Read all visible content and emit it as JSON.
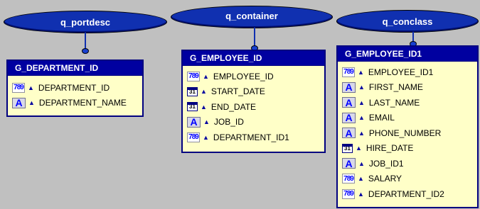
{
  "queries": [
    {
      "name": "q_portdesc"
    },
    {
      "name": "q_container"
    },
    {
      "name": "q_conclass"
    }
  ],
  "groups": [
    {
      "name": "G_DEPARTMENT_ID",
      "columns": [
        {
          "type_icon": "number-icon",
          "icon_text": "789",
          "name": "DEPARTMENT_ID"
        },
        {
          "type_icon": "text-icon",
          "icon_text": "A",
          "name": "DEPARTMENT_NAME"
        }
      ]
    },
    {
      "name": "G_EMPLOYEE_ID",
      "columns": [
        {
          "type_icon": "number-icon",
          "icon_text": "789",
          "name": "EMPLOYEE_ID"
        },
        {
          "type_icon": "date-icon",
          "icon_text": "31",
          "name": "START_DATE"
        },
        {
          "type_icon": "date-icon",
          "icon_text": "31",
          "name": "END_DATE"
        },
        {
          "type_icon": "text-icon",
          "icon_text": "A",
          "name": "JOB_ID"
        },
        {
          "type_icon": "number-icon",
          "icon_text": "789",
          "name": "DEPARTMENT_ID1"
        }
      ]
    },
    {
      "name": "G_EMPLOYEE_ID1",
      "columns": [
        {
          "type_icon": "number-icon",
          "icon_text": "789",
          "name": "EMPLOYEE_ID1"
        },
        {
          "type_icon": "text-icon",
          "icon_text": "A",
          "name": "FIRST_NAME"
        },
        {
          "type_icon": "text-icon",
          "icon_text": "A",
          "name": "LAST_NAME"
        },
        {
          "type_icon": "text-icon",
          "icon_text": "A",
          "name": "EMAIL"
        },
        {
          "type_icon": "text-icon",
          "icon_text": "A",
          "name": "PHONE_NUMBER"
        },
        {
          "type_icon": "date-icon",
          "icon_text": "31",
          "name": "HIRE_DATE"
        },
        {
          "type_icon": "text-icon",
          "icon_text": "A",
          "name": "JOB_ID1"
        },
        {
          "type_icon": "number-icon",
          "icon_text": "789",
          "name": "SALARY"
        },
        {
          "type_icon": "number-icon",
          "icon_text": "789",
          "name": "DEPARTMENT_ID2"
        }
      ]
    }
  ],
  "colors": {
    "canvas": "#c0c0c0",
    "query_fill": "#1030b0",
    "group_header": "#0000a0",
    "group_body": "#ffffc8"
  }
}
